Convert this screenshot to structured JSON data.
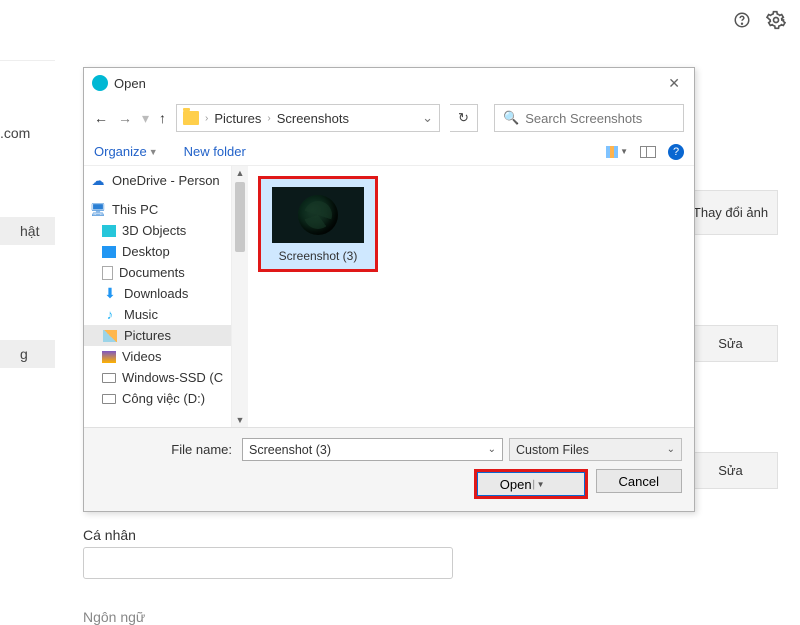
{
  "topbar": {
    "help_tooltip": "Help",
    "settings_tooltip": "Settings"
  },
  "background": {
    "left_rows": [
      ".com",
      "",
      "hật",
      "",
      "g"
    ],
    "right_buttons": {
      "change_image": "Thay đổi ảnh",
      "edit1": "Sửa",
      "edit2": "Sửa"
    },
    "bottom": {
      "personal": "Cá nhân",
      "language": "Ngôn ngữ"
    }
  },
  "dialog": {
    "title": "Open",
    "close_label": "Close",
    "nav": {
      "back": "←",
      "forward": "→",
      "up": "↑",
      "crumbs": [
        "Pictures",
        "Screenshots"
      ],
      "refresh": "↻",
      "search_placeholder": "Search Screenshots"
    },
    "toolbar": {
      "organize": "Organize",
      "new_folder": "New folder"
    },
    "tree": {
      "items": [
        {
          "label": "OneDrive - Person",
          "icon": "cloud"
        },
        {
          "label": "This PC",
          "icon": "pc",
          "indent": false,
          "gap": true
        },
        {
          "label": "3D Objects",
          "icon": "cyan",
          "indent": true
        },
        {
          "label": "Desktop",
          "icon": "blue",
          "indent": true
        },
        {
          "label": "Documents",
          "icon": "doc",
          "indent": true
        },
        {
          "label": "Downloads",
          "icon": "dl",
          "indent": true
        },
        {
          "label": "Music",
          "icon": "music",
          "indent": true
        },
        {
          "label": "Pictures",
          "icon": "pic",
          "indent": true,
          "active": true
        },
        {
          "label": "Videos",
          "icon": "vid",
          "indent": true
        },
        {
          "label": "Windows-SSD (C",
          "icon": "disk",
          "indent": true
        },
        {
          "label": "Công việc (D:)",
          "icon": "disk2",
          "indent": true
        }
      ]
    },
    "files": {
      "items": [
        {
          "label": "Screenshot (3)",
          "selected": true
        }
      ]
    },
    "footer": {
      "filename_label": "File name:",
      "filename_value": "Screenshot (3)",
      "filter_value": "Custom Files",
      "open": "Open",
      "cancel": "Cancel"
    }
  }
}
